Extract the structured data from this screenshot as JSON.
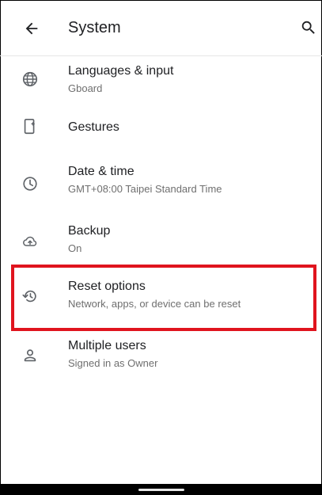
{
  "header": {
    "title": "System"
  },
  "items": [
    {
      "label": "Languages & input",
      "sub": "Gboard",
      "icon": "globe-icon"
    },
    {
      "label": "Gestures",
      "sub": "",
      "icon": "gesture-phone-icon"
    },
    {
      "label": "Date & time",
      "sub": "GMT+08:00 Taipei Standard Time",
      "icon": "clock-icon"
    },
    {
      "label": "Backup",
      "sub": "On",
      "icon": "cloud-upload-icon"
    },
    {
      "label": "Reset options",
      "sub": "Network, apps, or device can be reset",
      "icon": "history-icon"
    },
    {
      "label": "Multiple users",
      "sub": "Signed in as Owner",
      "icon": "person-icon"
    }
  ],
  "colors": {
    "highlight": "#e0141e",
    "text_primary": "#202124",
    "text_secondary": "#6f6f6f"
  }
}
